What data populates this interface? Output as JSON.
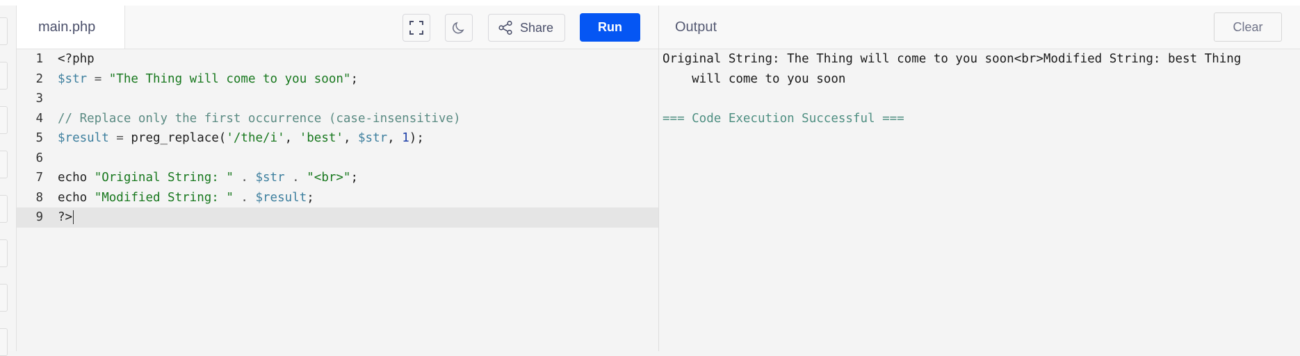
{
  "editor": {
    "file_tab": "main.php",
    "share_label": "Share",
    "run_label": "Run",
    "icons": [
      "fullscreen-icon",
      "moon-icon",
      "share-icon"
    ],
    "lines": [
      {
        "num": "1",
        "tokens": [
          {
            "t": "<?php",
            "k": "plain"
          }
        ]
      },
      {
        "num": "2",
        "tokens": [
          {
            "t": "$str",
            "k": "var"
          },
          {
            "t": " = ",
            "k": "op"
          },
          {
            "t": "\"The Thing will come to you soon\"",
            "k": "str"
          },
          {
            "t": ";",
            "k": "plain"
          }
        ]
      },
      {
        "num": "3",
        "tokens": []
      },
      {
        "num": "4",
        "tokens": [
          {
            "t": "// Replace only the first occurrence (case-insensitive)",
            "k": "com"
          }
        ]
      },
      {
        "num": "5",
        "tokens": [
          {
            "t": "$result",
            "k": "var"
          },
          {
            "t": " = ",
            "k": "op"
          },
          {
            "t": "preg_replace(",
            "k": "plain"
          },
          {
            "t": "'/the/i'",
            "k": "str"
          },
          {
            "t": ", ",
            "k": "plain"
          },
          {
            "t": "'best'",
            "k": "str"
          },
          {
            "t": ", ",
            "k": "plain"
          },
          {
            "t": "$str",
            "k": "var"
          },
          {
            "t": ", ",
            "k": "plain"
          },
          {
            "t": "1",
            "k": "num"
          },
          {
            "t": ");",
            "k": "plain"
          }
        ]
      },
      {
        "num": "6",
        "tokens": []
      },
      {
        "num": "7",
        "tokens": [
          {
            "t": "echo ",
            "k": "plain"
          },
          {
            "t": "\"Original String: \"",
            "k": "str"
          },
          {
            "t": " . ",
            "k": "op"
          },
          {
            "t": "$str",
            "k": "var"
          },
          {
            "t": " . ",
            "k": "op"
          },
          {
            "t": "\"<br>\"",
            "k": "str"
          },
          {
            "t": ";",
            "k": "plain"
          }
        ]
      },
      {
        "num": "8",
        "tokens": [
          {
            "t": "echo ",
            "k": "plain"
          },
          {
            "t": "\"Modified String: \"",
            "k": "str"
          },
          {
            "t": " . ",
            "k": "op"
          },
          {
            "t": "$result",
            "k": "var"
          },
          {
            "t": ";",
            "k": "plain"
          }
        ]
      },
      {
        "num": "9",
        "tokens": [
          {
            "t": "?>",
            "k": "plain"
          }
        ],
        "active": true
      }
    ]
  },
  "output": {
    "title": "Output",
    "clear_label": "Clear",
    "lines": [
      "Original String: The Thing will come to you soon<br>Modified String: best Thing",
      "    will come to you soon",
      "",
      "=== Code Execution Successful ==="
    ]
  },
  "colors": {
    "run_button": "#0556f3",
    "variable": "#3d7f9e",
    "string": "#18781e",
    "comment": "#5b8b83",
    "success": "#4f8f82"
  }
}
